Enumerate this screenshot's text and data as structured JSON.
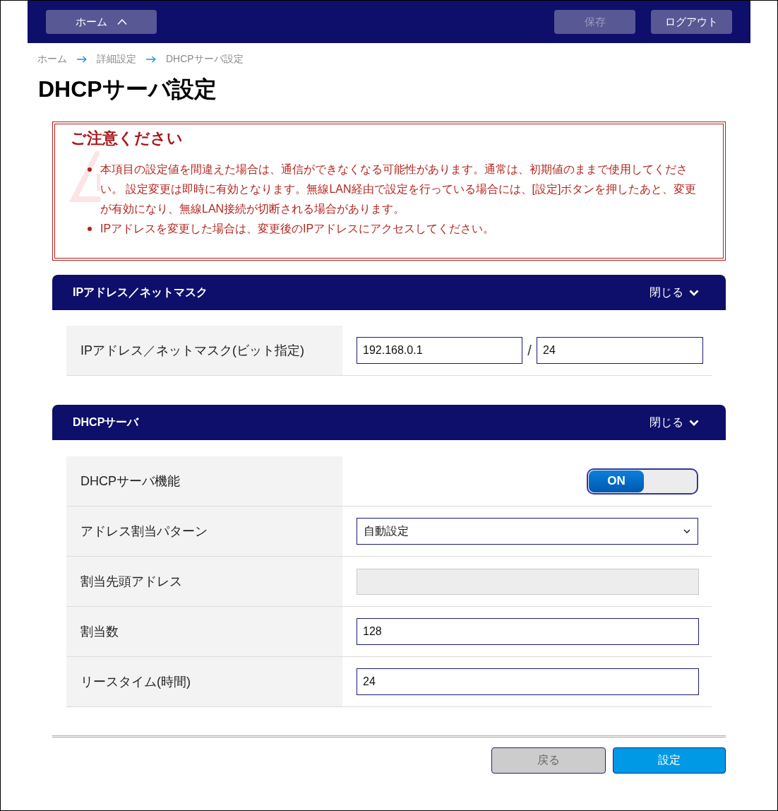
{
  "header": {
    "buttons": [
      {
        "label": "ホーム",
        "kind": "menu",
        "disabled": false
      },
      {
        "label": "保存",
        "kind": "action",
        "disabled": true
      },
      {
        "label": "ログアウト",
        "kind": "action",
        "disabled": false
      }
    ]
  },
  "breadcrumb": [
    "ホーム",
    "詳細設定",
    "DHCPサーバ設定"
  ],
  "title": "DHCPサーバ設定",
  "notice": {
    "title": "ご注意ください",
    "items": [
      "本項目の設定値を間違えた場合は、通信ができなくなる可能性があります。通常は、初期値のままで使用してください。 設定変更は即時に有効となります。無線LAN経由で設定を行っている場合には、[設定]ボタンを押したあと、変更が有効になり、無線LAN接続が切断される場合があります。",
      "IPアドレスを変更した場合は、変更後のIPアドレスにアクセスしてください。"
    ]
  },
  "sections": [
    {
      "title": "IPアドレス／ネットマスク",
      "toggle_label": "閉じる",
      "expanded": true,
      "rows": [
        {
          "kind": "ip_mask",
          "label": "IPアドレス／ネットマスク(ビット指定)",
          "value": "192.168.0.1",
          "separator": "/",
          "mask": "24"
        }
      ]
    },
    {
      "title": "DHCPサーバ",
      "toggle_label": "閉じる",
      "expanded": true,
      "rows": [
        {
          "kind": "switch",
          "label": "DHCPサーバ機能",
          "on": true,
          "on_label": "ON"
        },
        {
          "kind": "select",
          "label": "アドレス割当パターン",
          "value": "自動設定"
        },
        {
          "kind": "text",
          "label": "割当先頭アドレス",
          "disabled": true
        },
        {
          "kind": "text",
          "label": "割当数",
          "value": "128",
          "disabled": false
        },
        {
          "kind": "text",
          "label": "リースタイム(時間)",
          "value": "24",
          "disabled": false
        }
      ]
    }
  ],
  "footer_buttons": [
    {
      "label": "戻る",
      "disabled": true
    },
    {
      "label": "設定",
      "disabled": false
    }
  ]
}
